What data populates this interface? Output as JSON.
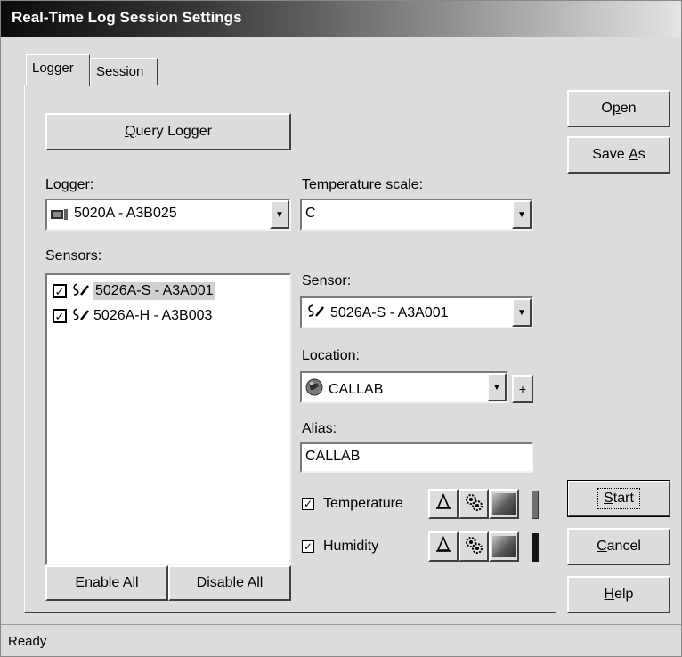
{
  "window": {
    "title": "Real-Time Log Session Settings"
  },
  "tabs": [
    {
      "label": "Logger",
      "active": true
    },
    {
      "label": "Session",
      "active": false
    }
  ],
  "logger_tab": {
    "query_button": {
      "pre": "",
      "mnemonic": "Q",
      "post": "uery Logger"
    },
    "logger_label": "Logger:",
    "logger_value": "5020A - A3B025",
    "temp_scale_label": "Temperature scale:",
    "temp_scale_value": "C",
    "sensors_label": "Sensors:",
    "sensors": [
      {
        "label": "5026A-S - A3A001",
        "checked": true,
        "selected": true
      },
      {
        "label": "5026A-H - A3B003",
        "checked": true,
        "selected": false
      }
    ],
    "sensor_label": "Sensor:",
    "sensor_value": "5026A-S - A3A001",
    "location_label": "Location:",
    "location_value": "CALLAB",
    "location_add": "+",
    "alias_label": "Alias:",
    "alias_value": "CALLAB",
    "measurements": [
      {
        "label": "Temperature",
        "checked": true,
        "bar_color": "#707070"
      },
      {
        "label": "Humidity",
        "checked": true,
        "bar_color": "#141414"
      }
    ],
    "enable_all": {
      "pre": "",
      "mnemonic": "E",
      "post": "nable All"
    },
    "disable_all": {
      "pre": "",
      "mnemonic": "D",
      "post": "isable All"
    }
  },
  "side_buttons": {
    "open": {
      "pre": "O",
      "mnemonic": "p",
      "post": "en"
    },
    "save_as": {
      "pre": "Save ",
      "mnemonic": "A",
      "post": "s"
    },
    "start": {
      "pre": "",
      "mnemonic": "S",
      "post": "tart"
    },
    "cancel": {
      "pre": "",
      "mnemonic": "C",
      "post": "ancel"
    },
    "help": {
      "pre": "",
      "mnemonic": "H",
      "post": "elp"
    }
  },
  "icons": {
    "logger": "logger-device-icon",
    "sensor": "probe-icon",
    "location": "globe-icon",
    "alarm": "bell-icon",
    "settings": "gears-icon",
    "color": "gradient-color-icon"
  },
  "status": {
    "text": "Ready"
  }
}
